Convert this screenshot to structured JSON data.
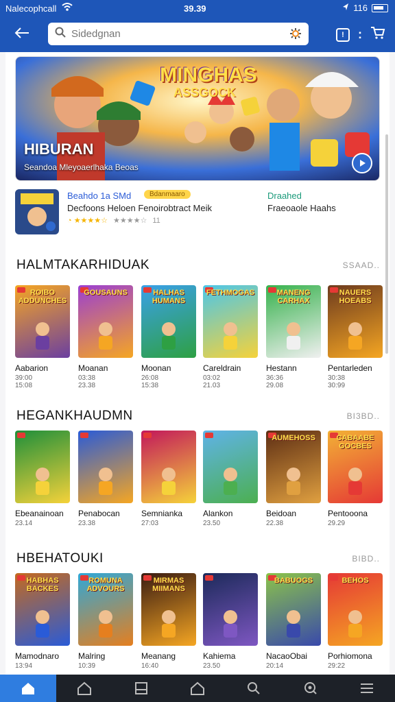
{
  "status_bar": {
    "carrier": "Nalecophcall",
    "time": "39.39",
    "battery_text": "116"
  },
  "search": {
    "placeholder": "Sidedgnan"
  },
  "hero": {
    "title": "HIBURAN",
    "subtitle": "Seandoa Mleyoaerlhaka Beoas",
    "logo_line1": "MINGHAS",
    "logo_line2": "ASSGOCK"
  },
  "featured": {
    "title": "Beahdo 1a SMd",
    "tag": "Bdanmaaro",
    "description": "Decfoons Heloen Fenoirobtract Meik",
    "rating_count": "11",
    "right_title": "Draahed",
    "right_description": "Fraeoaole Haahs"
  },
  "sections": [
    {
      "title": "HALMTAKARHIDUAK",
      "more": "SSAAD..",
      "items": [
        {
          "name": "Aabarion",
          "meta1": "39:00",
          "meta2": "15:08",
          "label": "ROIBO ADDUNCHES",
          "bg": "#f5a623",
          "accent": "#6b3fa0"
        },
        {
          "name": "Moanan",
          "meta1": "03:38",
          "meta2": "23.38",
          "label": "GOUSAUNS",
          "bg": "#9b3fd1",
          "accent": "#f5a623"
        },
        {
          "name": "Moonan",
          "meta1": "26:08",
          "meta2": "15:38",
          "label": "HALHAS HUMANS",
          "bg": "#3aa0e8",
          "accent": "#2ea043"
        },
        {
          "name": "Careldrain",
          "meta1": "03:02",
          "meta2": "21.03",
          "label": "FETHMOGAS",
          "bg": "#4cc6e8",
          "accent": "#f5d23a"
        },
        {
          "name": "Hestann",
          "meta1": "36:36",
          "meta2": "29.08",
          "label": "MANENG CARHAX",
          "bg": "#37b24d",
          "accent": "#f0f0f0"
        },
        {
          "name": "Pentarleden",
          "meta1": "30:38",
          "meta2": "30:99",
          "label": "NAUERS HOEABS",
          "bg": "#6d3b1e",
          "accent": "#f5a623"
        }
      ]
    },
    {
      "title": "HEGANKHAUDMN",
      "more": "BI3BD..",
      "items": [
        {
          "name": "Ebeanainoan",
          "meta1": "23.14",
          "meta2": "",
          "label": "",
          "bg": "#1f8f3a",
          "accent": "#f5d23a"
        },
        {
          "name": "Penabocan",
          "meta1": "23.38",
          "meta2": "",
          "label": "",
          "bg": "#2a5bd7",
          "accent": "#f5a623"
        },
        {
          "name": "Semnianka",
          "meta1": "27:03",
          "meta2": "",
          "label": "",
          "bg": "#c2185b",
          "accent": "#f5d23a"
        },
        {
          "name": "Alankon",
          "meta1": "23.50",
          "meta2": "",
          "label": "",
          "bg": "#5fb3e8",
          "accent": "#4caf50"
        },
        {
          "name": "Beidoan",
          "meta1": "22.38",
          "meta2": "",
          "label": "AUMEHOSS",
          "bg": "#5d2e14",
          "accent": "#e0a040"
        },
        {
          "name": "Pentooona",
          "meta1": "29.29",
          "meta2": "",
          "label": "CABAABE GOCBES",
          "bg": "#f2b136",
          "accent": "#e53935"
        }
      ]
    },
    {
      "title": "HBEHATOUKI",
      "more": "BIBD..",
      "items": [
        {
          "name": "Mamodnaro",
          "meta1": "13:94",
          "meta2": "",
          "label": "HABHAS BACKES",
          "bg": "#c46a1f",
          "accent": "#2a5bd7"
        },
        {
          "name": "Malring",
          "meta1": "10:39",
          "meta2": "",
          "label": "ROMUNA ADVOURS",
          "bg": "#2fa8d8",
          "accent": "#e57f1f"
        },
        {
          "name": "Meanang",
          "meta1": "16:40",
          "meta2": "",
          "label": "MIRMAS MIIMANS",
          "bg": "#3a1c12",
          "accent": "#f5a623"
        },
        {
          "name": "Kahiema",
          "meta1": "23.50",
          "meta2": "",
          "label": "",
          "bg": "#1c2a5a",
          "accent": "#7e57c2"
        },
        {
          "name": "NacaoObai",
          "meta1": "20:14",
          "meta2": "",
          "label": "BABUOGS",
          "bg": "#8bc34a",
          "accent": "#3949ab"
        },
        {
          "name": "Porhiomona",
          "meta1": "29:22",
          "meta2": "",
          "label": "BEHOS",
          "bg": "#e53935",
          "accent": "#f5a623"
        }
      ]
    }
  ],
  "icons": {
    "back": "back-arrow-icon",
    "search": "search-icon",
    "mic": "settings-icon",
    "profile": "profile-icon",
    "menu": "more-icon",
    "cart": "cart-icon",
    "nav": [
      "home-icon",
      "library-icon",
      "tablet-icon",
      "store-icon",
      "search-icon",
      "discover-icon",
      "menu-icon"
    ]
  },
  "colors": {
    "primary": "#1e56b8",
    "nav_active": "#2f7de0",
    "nav_bg": "#1d2128",
    "rating": "#f5b400"
  }
}
